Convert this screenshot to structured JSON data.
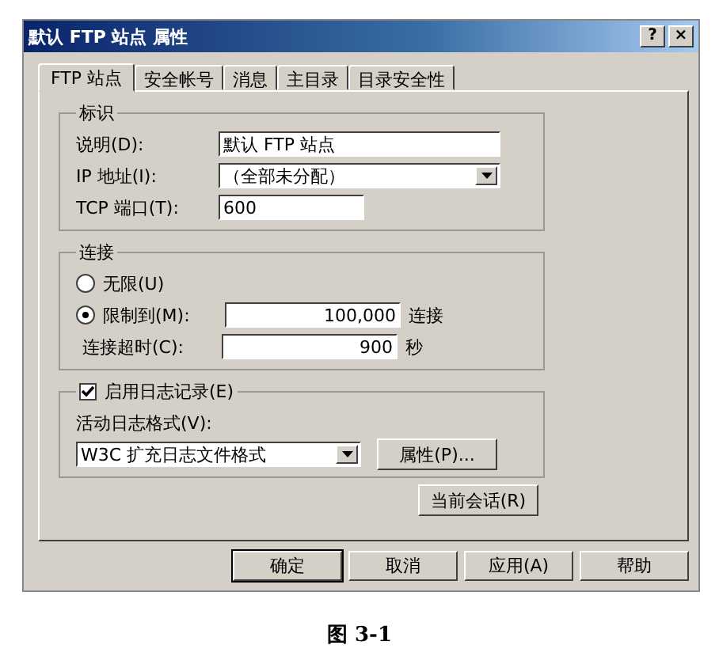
{
  "window": {
    "title": "默认 FTP 站点 属性",
    "title_buttons": [
      "?",
      "×"
    ]
  },
  "tabs": [
    {
      "label": "FTP 站点",
      "selected": true
    },
    {
      "label": "安全帐号",
      "selected": false
    },
    {
      "label": "消息",
      "selected": false
    },
    {
      "label": "主目录",
      "selected": false
    },
    {
      "label": "目录安全性",
      "selected": false
    }
  ],
  "identification": {
    "title": "标识",
    "fields": [
      {
        "kind": "text",
        "label": "说明(D):",
        "value": "默认 FTP 站点"
      },
      {
        "kind": "combo",
        "label": "IP 地址(I):",
        "value": "（全部未分配）"
      },
      {
        "kind": "short",
        "label": "TCP 端口(T):",
        "value": "600"
      }
    ]
  },
  "connection": {
    "title": "连接",
    "options": [
      {
        "label": "无限(U)",
        "selected": false
      },
      {
        "label": "限制到(M):",
        "selected": true,
        "value": "100,000",
        "unit": "连接"
      }
    ],
    "timeout": {
      "label": "连接超时(C):",
      "value": "900",
      "unit": "秒"
    }
  },
  "logging": {
    "label": "启用日志记录(E)",
    "checked": true,
    "format_label": "活动日志格式(V):",
    "format_value": "W3C 扩充日志文件格式",
    "properties_button": "属性(P)..."
  },
  "current_sessions_button": "当前会话(R)",
  "buttons": [
    {
      "label": "确定",
      "default": true
    },
    {
      "label": "取消",
      "default": false
    },
    {
      "label": "应用(A)",
      "default": false
    },
    {
      "label": "帮助",
      "default": false
    }
  ],
  "caption": "图 3-1"
}
